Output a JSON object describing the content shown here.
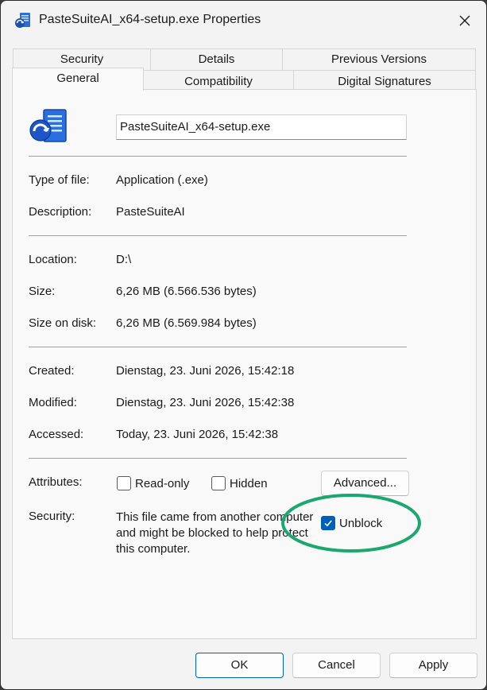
{
  "window": {
    "title": "PasteSuiteAI_x64-setup.exe Properties"
  },
  "tabs": {
    "row1": [
      "Security",
      "Details",
      "Previous Versions"
    ],
    "row2": [
      "General",
      "Compatibility",
      "Digital Signatures"
    ],
    "active": "General"
  },
  "file": {
    "name": "PasteSuiteAI_x64-setup.exe"
  },
  "info": {
    "type_label": "Type of file:",
    "type_value": "Application (.exe)",
    "desc_label": "Description:",
    "desc_value": "PasteSuiteAI",
    "location_label": "Location:",
    "location_value": "D:\\",
    "size_label": "Size:",
    "size_value": "6,26 MB (6.566.536 bytes)",
    "disk_label": "Size on disk:",
    "disk_value": "6,26 MB (6.569.984 bytes)",
    "created_label": "Created:",
    "created_value": "Dienstag, 23. Juni 2026, 15:42:18",
    "modified_label": "Modified:",
    "modified_value": "Dienstag, 23. Juni 2026, 15:42:38",
    "accessed_label": "Accessed:",
    "accessed_value": "Today, 23. Juni 2026, 15:42:38"
  },
  "attributes": {
    "label": "Attributes:",
    "readonly": "Read-only",
    "readonly_checked": false,
    "hidden": "Hidden",
    "hidden_checked": false,
    "advanced": "Advanced..."
  },
  "security": {
    "label": "Security:",
    "text": "This file came from another computer and might be blocked to help protect this computer.",
    "unblock": "Unblock",
    "unblock_checked": true
  },
  "buttons": {
    "ok": "OK",
    "cancel": "Cancel",
    "apply": "Apply"
  },
  "colors": {
    "accent": "#005fb8",
    "highlight": "#1aa86e"
  }
}
